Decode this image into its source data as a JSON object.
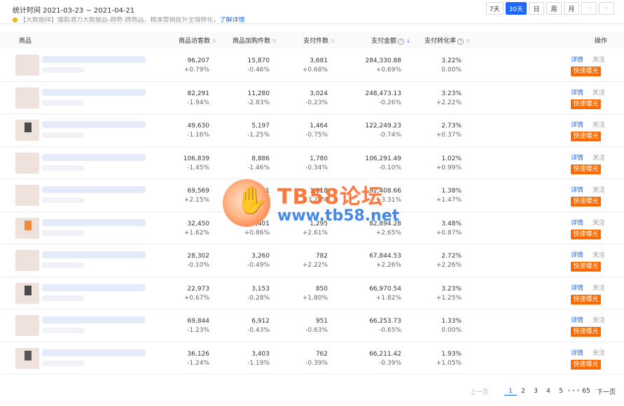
{
  "header": {
    "stat_time": "统计时间 2021-03-23 ~ 2021-04-21",
    "periods": [
      "7天",
      "30天",
      "日",
      "周",
      "月"
    ],
    "active_period": "30天",
    "prev_icon": "chevron-left-icon",
    "next_icon": "chevron-right-icon"
  },
  "notice": {
    "text": "【大数据择】爆款潜力大数据品-趋势-跨商品，精准营销提升全域转化，",
    "link": "了解详情"
  },
  "table": {
    "columns": {
      "product": "商品",
      "visitors": "商品访客数",
      "cart": "商品加购件数",
      "pay_items": "支付件数",
      "pay_amount": "支付金额",
      "conversion": "支付转化率",
      "action": "操作"
    },
    "actions": {
      "detail": "详情",
      "follow": "关注",
      "expose": "快速曝光"
    },
    "rows": [
      {
        "visitors": "96,207",
        "visitors_chg": "+0.79%",
        "cart": "15,870",
        "cart_chg": "-0.46%",
        "pay_items": "3,681",
        "pay_items_chg": "+0.68%",
        "pay_amount": "284,330.88",
        "pay_amount_chg": "+0.69%",
        "conversion": "3.22%",
        "conversion_chg": "0.00%"
      },
      {
        "visitors": "82,291",
        "visitors_chg": "-1.94%",
        "cart": "11,280",
        "cart_chg": "-2.83%",
        "pay_items": "3,024",
        "pay_items_chg": "-0.23%",
        "pay_amount": "248,473.13",
        "pay_amount_chg": "-0.26%",
        "conversion": "3.23%",
        "conversion_chg": "+2.22%"
      },
      {
        "visitors": "49,630",
        "visitors_chg": "-1.16%",
        "cart": "5,197",
        "cart_chg": "-1.25%",
        "pay_items": "1,464",
        "pay_items_chg": "-0.75%",
        "pay_amount": "122,249.23",
        "pay_amount_chg": "-0.74%",
        "conversion": "2.73%",
        "conversion_chg": "+0.37%"
      },
      {
        "visitors": "106,839",
        "visitors_chg": "-1.45%",
        "cart": "8,886",
        "cart_chg": "-1.46%",
        "pay_items": "1,780",
        "pay_items_chg": "-0.34%",
        "pay_amount": "106,291.49",
        "pay_amount_chg": "-0.10%",
        "conversion": "1.02%",
        "conversion_chg": "+0.99%"
      },
      {
        "visitors": "69,569",
        "visitors_chg": "+2.15%",
        "cart": "6,431",
        "cart_chg": "-1.10%",
        "pay_items": "1,118",
        "pay_items_chg": "+3.25%",
        "pay_amount": "92,408.66",
        "pay_amount_chg": "+3.31%",
        "conversion": "1.38%",
        "conversion_chg": "+1.47%"
      },
      {
        "visitors": "32,450",
        "visitors_chg": "+1.62%",
        "cart": "5,401",
        "cart_chg": "+0.86%",
        "pay_items": "1,295",
        "pay_items_chg": "+2.61%",
        "pay_amount": "82,894.28",
        "pay_amount_chg": "+2.65%",
        "conversion": "3.48%",
        "conversion_chg": "+0.87%"
      },
      {
        "visitors": "28,302",
        "visitors_chg": "-0.10%",
        "cart": "3,260",
        "cart_chg": "-0.49%",
        "pay_items": "782",
        "pay_items_chg": "+2.22%",
        "pay_amount": "67,844.53",
        "pay_amount_chg": "+2.26%",
        "conversion": "2.72%",
        "conversion_chg": "+2.26%"
      },
      {
        "visitors": "22,973",
        "visitors_chg": "+0.67%",
        "cart": "3,153",
        "cart_chg": "-0.28%",
        "pay_items": "850",
        "pay_items_chg": "+1.80%",
        "pay_amount": "66,970.54",
        "pay_amount_chg": "+1.82%",
        "conversion": "3.23%",
        "conversion_chg": "+1.25%"
      },
      {
        "visitors": "69,844",
        "visitors_chg": "-1.23%",
        "cart": "6,912",
        "cart_chg": "-0.43%",
        "pay_items": "951",
        "pay_items_chg": "-0.63%",
        "pay_amount": "66,253.73",
        "pay_amount_chg": "-0.65%",
        "conversion": "1.33%",
        "conversion_chg": "0.00%"
      },
      {
        "visitors": "36,126",
        "visitors_chg": "-1.24%",
        "cart": "3,403",
        "cart_chg": "-1.19%",
        "pay_items": "762",
        "pay_items_chg": "-0.39%",
        "pay_amount": "66,211.42",
        "pay_amount_chg": "-0.39%",
        "conversion": "1.93%",
        "conversion_chg": "+1.05%"
      }
    ]
  },
  "pagination": {
    "prev": "上一页",
    "pages": [
      "1",
      "2",
      "3",
      "4",
      "5"
    ],
    "active_page": "1",
    "ellipsis": "•••",
    "last": "65",
    "next": "下一页"
  },
  "watermark": {
    "title": "TB58论坛",
    "url": "www.tb58.net"
  },
  "colors": {
    "accent": "#1a66ff",
    "expose_button": "#ff6a00"
  }
}
